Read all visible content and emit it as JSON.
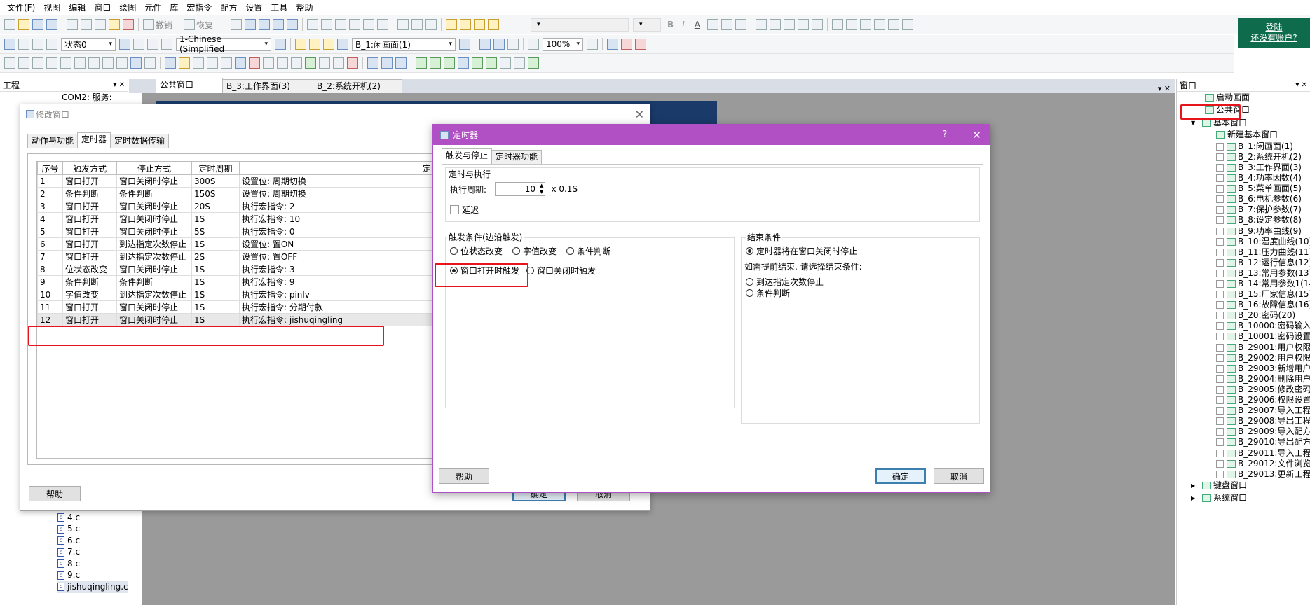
{
  "menu": [
    "文件(F)",
    "视图",
    "编辑",
    "窗口",
    "绘图",
    "元件",
    "库",
    "宏指令",
    "配方",
    "设置",
    "工具",
    "帮助"
  ],
  "toolbar1": {
    "undo": "撤销",
    "redo": "恢复"
  },
  "toolbar2": {
    "state": "状态0",
    "language": "1-Chinese (Simplified",
    "screen": "B_1:闲画面(1)",
    "zoom": "100%"
  },
  "login": {
    "login": "登陆",
    "no_account": "还没有账户?"
  },
  "project_panel": {
    "title": "工程",
    "com_item": "COM2: 服务:",
    "files": [
      "4.c",
      "5.c",
      "6.c",
      "7.c",
      "8.c",
      "9.c",
      "jishuqingling.c"
    ]
  },
  "doc_tabs": [
    "公共窗口",
    "B_3:工作界面(3)",
    "B_2:系统开机(2)"
  ],
  "modify_dialog": {
    "title": "修改窗口",
    "tabs": [
      "动作与功能",
      "定时器",
      "定时数据传输"
    ],
    "columns": [
      "序号",
      "触发方式",
      "停止方式",
      "定时周期",
      "定时功能"
    ],
    "rows": [
      [
        "1",
        "窗口打开",
        "窗口关闭时停止",
        "300S",
        "设置位: 周期切换"
      ],
      [
        "2",
        "条件判断",
        "条件判断",
        "150S",
        "设置位: 周期切换"
      ],
      [
        "3",
        "窗口打开",
        "窗口关闭时停止",
        "20S",
        "执行宏指令: 2"
      ],
      [
        "4",
        "窗口打开",
        "窗口关闭时停止",
        "1S",
        "执行宏指令: 10"
      ],
      [
        "5",
        "窗口打开",
        "窗口关闭时停止",
        "5S",
        "执行宏指令: 0"
      ],
      [
        "6",
        "窗口打开",
        "到达指定次数停止",
        "1S",
        "设置位: 置ON"
      ],
      [
        "7",
        "窗口打开",
        "到达指定次数停止",
        "2S",
        "设置位: 置OFF"
      ],
      [
        "8",
        "位状态改变",
        "窗口关闭时停止",
        "1S",
        "执行宏指令: 3"
      ],
      [
        "9",
        "条件判断",
        "条件判断",
        "1S",
        "执行宏指令: 9"
      ],
      [
        "10",
        "字值改变",
        "到达指定次数停止",
        "1S",
        "执行宏指令: pinlv"
      ],
      [
        "11",
        "窗口打开",
        "窗口关闭时停止",
        "1S",
        "执行宏指令: 分期付款"
      ],
      [
        "12",
        "窗口打开",
        "窗口关闭时停止",
        "1S",
        "执行宏指令: jishuqingling"
      ]
    ],
    "help": "帮助",
    "ok": "确定",
    "cancel": "取消"
  },
  "timer_dialog": {
    "title": "定时器",
    "help_q": "?",
    "tabs": [
      "触发与停止",
      "定时器功能"
    ],
    "exec_group": "定时与执行",
    "period_label": "执行周期:",
    "period_value": "10",
    "period_unit": "x 0.1S",
    "delay": "延迟",
    "trigger_group": "触发条件(边沿触发)",
    "trigger_options": [
      "位状态改变",
      "字值改变",
      "条件判断",
      "窗口打开时触发",
      "窗口关闭时触发"
    ],
    "end_group": "结束条件",
    "end_default": "定时器将在窗口关闭时停止",
    "end_hint": "如需提前结束, 请选择结束条件:",
    "end_options": [
      "到达指定次数停止",
      "条件判断"
    ],
    "help": "帮助",
    "ok": "确定",
    "cancel": "取消"
  },
  "window_panel": {
    "title": "窗口",
    "start_screen": "启动画面",
    "public_window": "公共窗口",
    "basic_window": "基本窗口",
    "new_basic": "新建基本窗口",
    "screens": [
      "B_1:闲画面(1)",
      "B_2:系统开机(2)",
      "B_3:工作界面(3)",
      "B_4:功率因数(4)",
      "B_5:菜单画面(5)",
      "B_6:电机参数(6)",
      "B_7:保护参数(7)",
      "B_8:设定参数(8)",
      "B_9:功率曲线(9)",
      "B_10:温度曲线(10)",
      "B_11:压力曲线(11)",
      "B_12:运行信息(12)",
      "B_13:常用参数(13)",
      "B_14:常用参数1(14)",
      "B_15:厂家信息(15)",
      "B_16:故障信息(16)",
      "B_20:密码(20)",
      "B_10000:密码输入(10",
      "B_10001:密码设置(10",
      "B_29001:用户权限浏览",
      "B_29002:用户权限登录",
      "B_29003:新增用户权限",
      "B_29004:删除用户权限",
      "B_29005:修改密码(29",
      "B_29006:权限设置(29",
      "B_29007:导入工程(29",
      "B_29008:导出工程(29",
      "B_29009:导入配方(29",
      "B_29010:导出配方(29",
      "B_29011:导入工程选项",
      "B_29012:文件浏览(29",
      "B_29013:更新工程(29"
    ],
    "keyboard_window": "键盘窗口",
    "system_window": "系统窗口"
  }
}
